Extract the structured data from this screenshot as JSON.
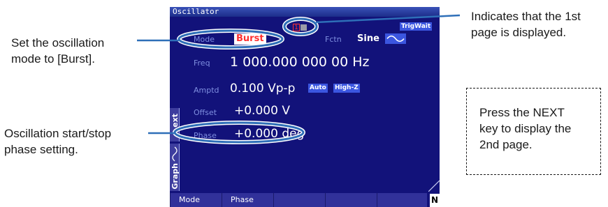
{
  "callouts": {
    "mode": [
      "Set the oscillation",
      "mode to [Burst]."
    ],
    "phase": [
      "Oscillation start/stop",
      "phase setting."
    ],
    "page": [
      "Indicates that the 1st",
      "page is displayed."
    ],
    "next": [
      "Press the NEXT",
      "key to display the",
      "2nd page."
    ]
  },
  "screen": {
    "title": "Oscillator",
    "page_indicator": "1",
    "trig_wait": "TrigWait",
    "mode": {
      "label": "Mode",
      "value": "Burst"
    },
    "fctn": {
      "label": "Fctn",
      "value": "Sine"
    },
    "freq": {
      "label": "Freq",
      "value": "1 000.000 000 00 Hz"
    },
    "amptd": {
      "label": "Amptd",
      "value": "0.100 Vp-p",
      "auto": "Auto",
      "highz": "High-Z"
    },
    "offset": {
      "label": "Offset",
      "value": "+0.000 V"
    },
    "phase": {
      "label": "Phase",
      "value": "+0.000 deg"
    },
    "side_tabs": {
      "text": "ext",
      "graph": "Graph"
    },
    "softkeys": [
      "Mode",
      "Phase",
      "",
      "",
      "",
      ""
    ],
    "next_mark": "N"
  },
  "colors": {
    "screen_bg": "#12127a",
    "burst": "#ff3030",
    "highlight_oval": "#2e6fb8",
    "tag": "#3b56e0"
  }
}
